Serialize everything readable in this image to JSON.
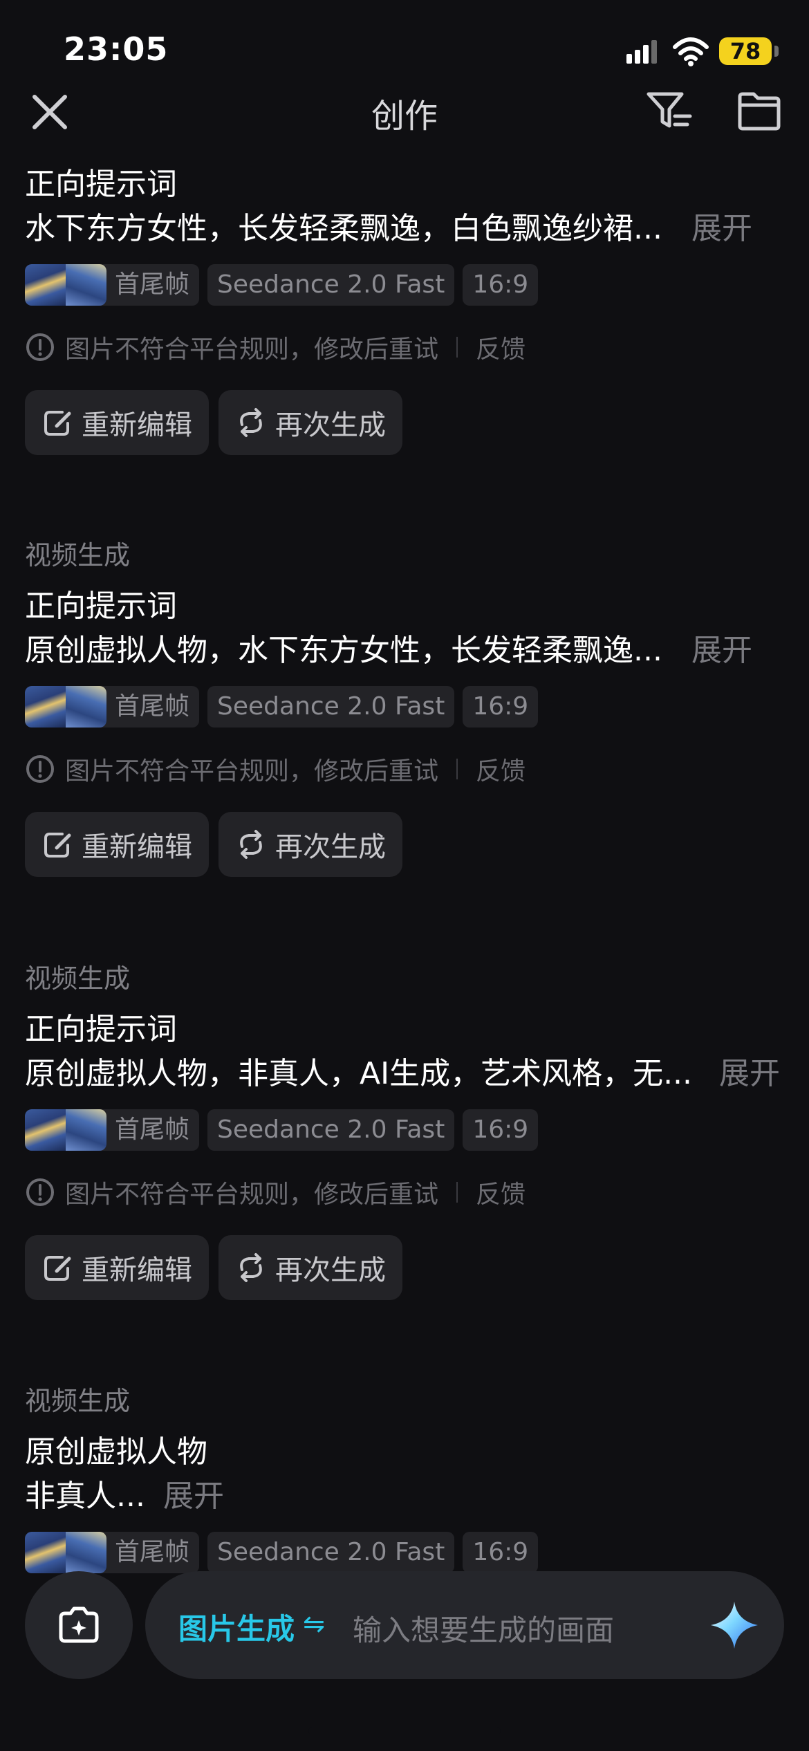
{
  "status": {
    "time": "23:05",
    "battery": "78"
  },
  "header": {
    "title": "创作"
  },
  "cards": [
    {
      "type": "",
      "prompt_label": "正向提示词",
      "prompt": "水下东方女性，长发轻柔飘逸，白色飘逸纱裙...",
      "expand": "展开",
      "tags": {
        "frames": "首尾帧",
        "model": "Seedance 2.0 Fast",
        "ratio": "16:9"
      },
      "error": "图片不符合平台规则，修改后重试",
      "feedback": "反馈",
      "reedit": "重新编辑",
      "regenerate": "再次生成"
    },
    {
      "type": "视频生成",
      "prompt_label": "正向提示词",
      "prompt": "原创虚拟人物，水下东方女性，长发轻柔飘逸...",
      "expand": "展开",
      "tags": {
        "frames": "首尾帧",
        "model": "Seedance 2.0 Fast",
        "ratio": "16:9"
      },
      "error": "图片不符合平台规则，修改后重试",
      "feedback": "反馈",
      "reedit": "重新编辑",
      "regenerate": "再次生成"
    },
    {
      "type": "视频生成",
      "prompt_label": "正向提示词",
      "prompt": "原创虚拟人物，非真人，AI生成，艺术风格，无...",
      "expand": "展开",
      "tags": {
        "frames": "首尾帧",
        "model": "Seedance 2.0 Fast",
        "ratio": "16:9"
      },
      "error": "图片不符合平台规则，修改后重试",
      "feedback": "反馈",
      "reedit": "重新编辑",
      "regenerate": "再次生成"
    },
    {
      "type": "视频生成",
      "prompt_label": "原创虚拟人物",
      "prompt": "非真人...",
      "expand": "展开",
      "tags": {
        "frames": "首尾帧",
        "model": "Seedance 2.0 Fast",
        "ratio": "16:9"
      }
    }
  ],
  "bottom": {
    "mode": "图片生成",
    "mode_switch": "⇋",
    "placeholder": "输入想要生成的画面"
  },
  "colors": {
    "accent": "#28c8e8",
    "battery": "#f4d21e",
    "background": "#0f0f12"
  }
}
